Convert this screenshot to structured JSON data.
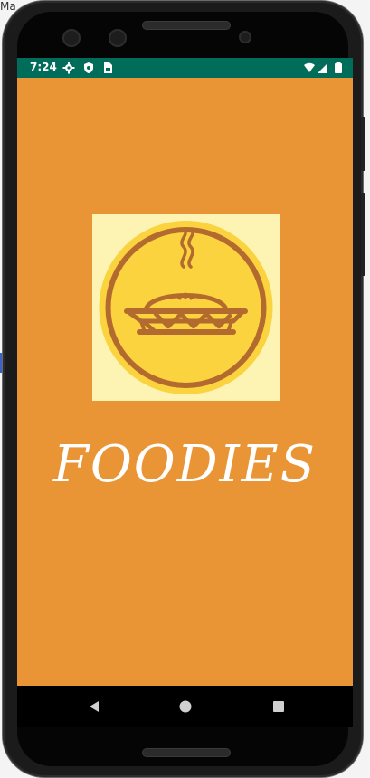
{
  "desktop": {
    "label": "Ma"
  },
  "status_bar": {
    "time": "7:24",
    "left_icons": [
      "gear-icon",
      "shield-icon",
      "sim-card-icon"
    ],
    "right_icons": [
      "wifi-icon",
      "cellular-signal-icon",
      "battery-icon"
    ],
    "color": "#006d5b"
  },
  "splash": {
    "title": "FOODIES",
    "background": "#e99536",
    "logo": "pie-icon"
  },
  "navigation": {
    "buttons": [
      "back-button",
      "home-button",
      "recents-button"
    ]
  }
}
